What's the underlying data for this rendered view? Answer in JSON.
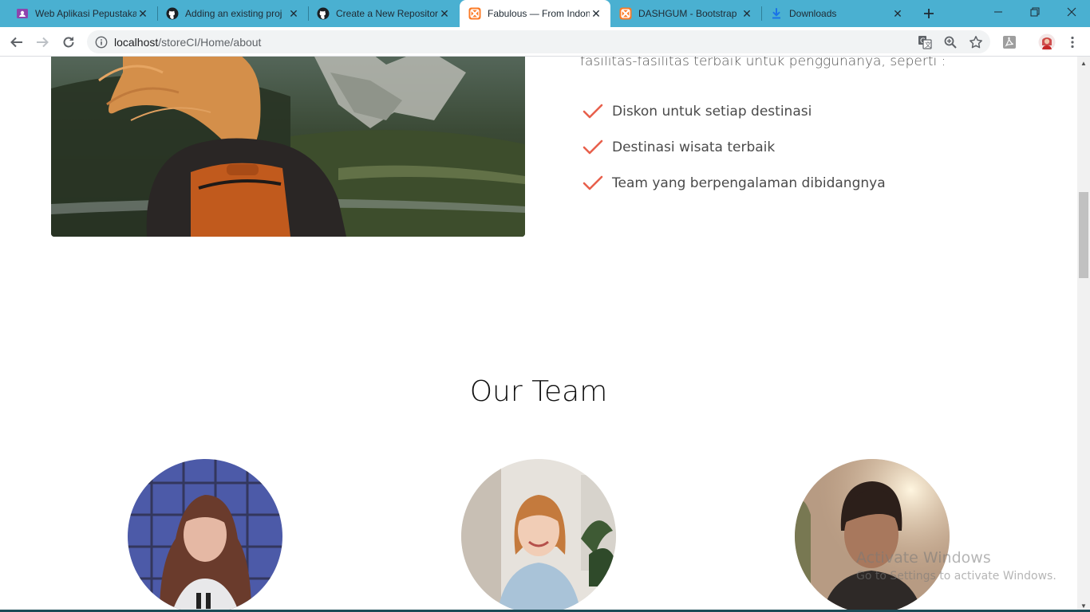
{
  "browser": {
    "tabs": [
      {
        "title": "Web Aplikasi Pepustaka",
        "icon": "classroom-icon",
        "active": false
      },
      {
        "title": "Adding an existing proj",
        "icon": "github-icon",
        "active": false
      },
      {
        "title": "Create a New Repositor",
        "icon": "github-icon",
        "active": false
      },
      {
        "title": "Fabulous — From Indon",
        "icon": "xampp-icon",
        "active": true
      },
      {
        "title": "DASHGUM - Bootstrap",
        "icon": "xampp-icon",
        "active": false
      },
      {
        "title": "Downloads",
        "icon": "download-icon",
        "active": false
      }
    ],
    "url_host": "localhost",
    "url_path": "/storeCI/Home/about",
    "accent_color": "#4ab0d1"
  },
  "about": {
    "intro": "fasilitas-fasilitas terbaik untuk penggunanya, seperti :",
    "features": [
      "Diskon untuk setiap destinasi",
      "Destinasi wisata terbaik",
      "Team yang berpengalaman dibidangnya"
    ],
    "check_color": "#e8604c"
  },
  "team": {
    "title": "Our Team"
  },
  "watermark": {
    "line1": "Activate Windows",
    "line2": "Go to Settings to activate Windows."
  }
}
